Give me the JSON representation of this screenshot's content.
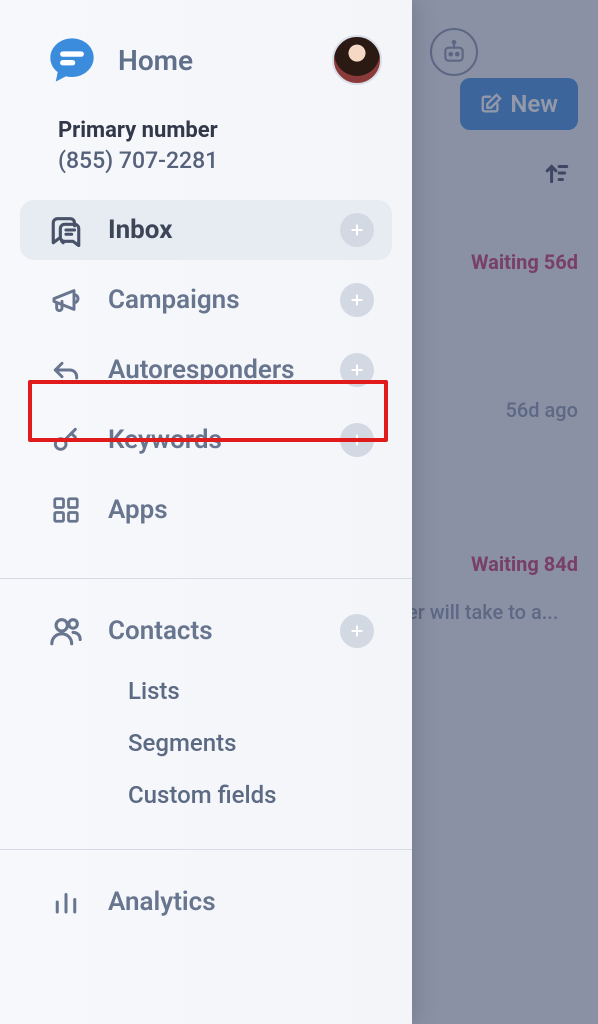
{
  "background": {
    "new_button": "New",
    "row1": "Waiting 56d",
    "row2": "56d ago",
    "row3": "Waiting 84d",
    "row4": "er will take to a..."
  },
  "sidebar": {
    "title": "Home",
    "primary_label": "Primary number",
    "primary_phone": "(855) 707-2281",
    "nav": {
      "inbox": "Inbox",
      "campaigns": "Campaigns",
      "autoresponders": "Autoresponders",
      "keywords": "Keywords",
      "apps": "Apps",
      "contacts": "Contacts",
      "analytics": "Analytics"
    },
    "sub": {
      "lists": "Lists",
      "segments": "Segments",
      "custom_fields": "Custom fields"
    }
  }
}
